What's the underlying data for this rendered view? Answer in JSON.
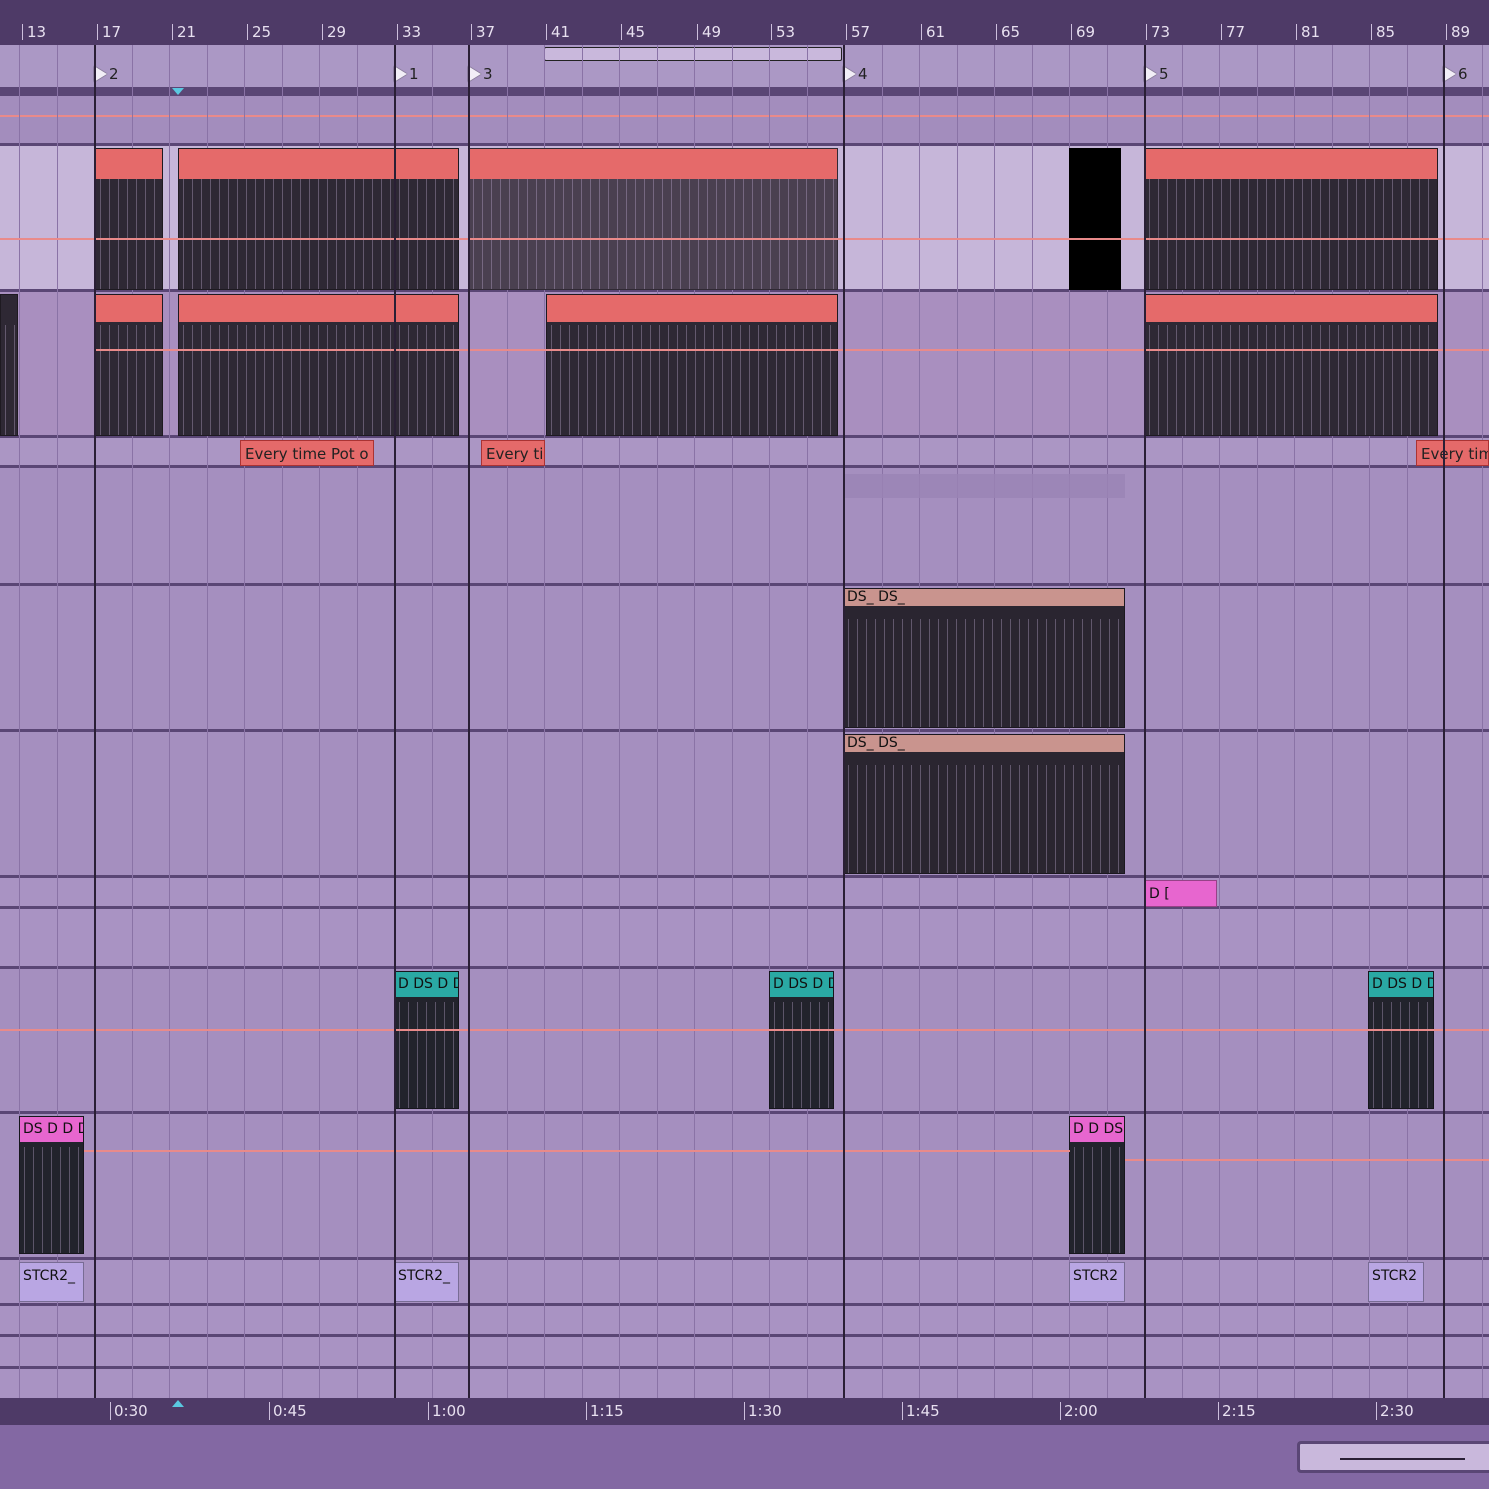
{
  "arrangement": {
    "bar_numbers": [
      "13",
      "17",
      "21",
      "25",
      "29",
      "33",
      "37",
      "41",
      "45",
      "49",
      "53",
      "57",
      "61",
      "65",
      "69",
      "73",
      "77",
      "81",
      "85",
      "89"
    ],
    "locators": [
      "2",
      "1",
      "3",
      "4",
      "5",
      "6"
    ],
    "time_labels": [
      "0:30",
      "0:45",
      "1:00",
      "1:15",
      "1:30",
      "1:45",
      "2:00",
      "2:15",
      "2:30"
    ]
  },
  "clips": {
    "note_clip_label": "Every time Pot o",
    "note_clip_label_2": "Every ti",
    "note_clip_label_3": "Every tim",
    "ds_a": "DS_",
    "ds_b": "DS_",
    "ds_c": "[",
    "ds_d": "I DS",
    "ds_e": "DS_",
    "ds_f": "DS_",
    "ds_g": "[",
    "ds_h": "I DS",
    "pink_small": "D [",
    "teal_1": "D DS D D",
    "teal_2": "D DS D D",
    "teal_3": "D DS D D",
    "pink_1": "DS D D D",
    "pink_2": "D D DS",
    "stcr_1": "STCR2_",
    "stcr_2": "STCR2_",
    "stcr_3": "STCR2",
    "stcr_4": "STCR2"
  },
  "colors": {
    "background": "#a58fbf",
    "ruler": "#4e3a67",
    "clip_red": "#e56a6a",
    "clip_salmon": "#c9948e",
    "clip_teal": "#2aa9a4",
    "clip_pink": "#e766cf",
    "clip_lavender": "#b9a6e3",
    "waveform": "#2a2530",
    "automation": "#e98a8a"
  }
}
